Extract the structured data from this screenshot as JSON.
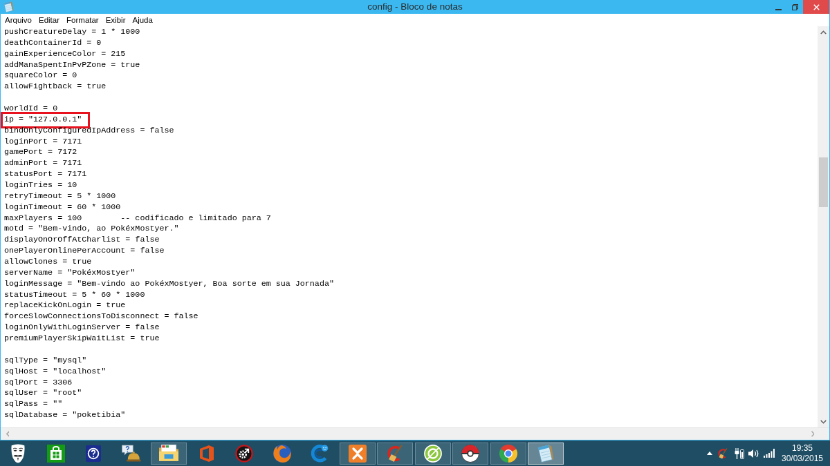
{
  "window": {
    "title": "config - Bloco de notas"
  },
  "menu": [
    "Arquivo",
    "Editar",
    "Formatar",
    "Exibir",
    "Ajuda"
  ],
  "editor": {
    "blocks": [
      {
        "lines": [
          {
            "text": "pushCreatureDelay = 1 * 1000",
            "highlighted": false
          },
          {
            "text": "deathContainerId = 0",
            "highlighted": false
          },
          {
            "text": "gainExperienceColor = 215",
            "highlighted": false
          },
          {
            "text": "addManaSpentInPvPZone = true",
            "highlighted": false
          },
          {
            "text": "squareColor = 0",
            "highlighted": false
          },
          {
            "text": "allowFightback = true",
            "highlighted": false
          }
        ]
      },
      {
        "lines": [
          {
            "text": "worldId = 0",
            "highlighted": false
          },
          {
            "text": "ip = \"127.0.0.1\"",
            "highlighted": true
          },
          {
            "text": "bindOnlyConfiguredIpAddress = false",
            "highlighted": false
          },
          {
            "text": "loginPort = 7171",
            "highlighted": false
          },
          {
            "text": "gamePort = 7172",
            "highlighted": false
          },
          {
            "text": "adminPort = 7171",
            "highlighted": false
          },
          {
            "text": "statusPort = 7171",
            "highlighted": false
          },
          {
            "text": "loginTries = 10",
            "highlighted": false
          },
          {
            "text": "retryTimeout = 5 * 1000",
            "highlighted": false
          },
          {
            "text": "loginTimeout = 60 * 1000",
            "highlighted": false
          },
          {
            "text": "maxPlayers = 100        -- codificado e limitado para 7",
            "highlighted": false
          },
          {
            "text": "motd = \"Bem-vindo, ao PokéxMostyer.\"",
            "highlighted": false
          },
          {
            "text": "displayOnOrOffAtCharlist = false",
            "highlighted": false
          },
          {
            "text": "onePlayerOnlinePerAccount = false",
            "highlighted": false
          },
          {
            "text": "allowClones = true",
            "highlighted": false
          },
          {
            "text": "serverName = \"PokéxMostyer\"",
            "highlighted": false
          },
          {
            "text": "loginMessage = \"Bem-vindo ao PokéxMostyer, Boa sorte em sua Jornada\"",
            "highlighted": false
          },
          {
            "text": "statusTimeout = 5 * 60 * 1000",
            "highlighted": false
          },
          {
            "text": "replaceKickOnLogin = true",
            "highlighted": false
          },
          {
            "text": "forceSlowConnectionsToDisconnect = false",
            "highlighted": false
          },
          {
            "text": "loginOnlyWithLoginServer = false",
            "highlighted": false
          },
          {
            "text": "premiumPlayerSkipWaitList = true",
            "highlighted": false
          }
        ]
      },
      {
        "lines": [
          {
            "text": "sqlType = \"mysql\"",
            "highlighted": false
          },
          {
            "text": "sqlHost = \"localhost\"",
            "highlighted": false
          },
          {
            "text": "sqlPort = 3306",
            "highlighted": false
          },
          {
            "text": "sqlUser = \"root\"",
            "highlighted": false
          },
          {
            "text": "sqlPass = \"\"",
            "highlighted": false
          },
          {
            "text": "sqlDatabase = \"poketibia\"",
            "highlighted": false
          }
        ]
      }
    ]
  },
  "taskbar": {
    "apps": [
      {
        "running": false,
        "selected": false
      },
      {
        "running": false,
        "selected": false
      },
      {
        "running": false,
        "selected": false
      },
      {
        "running": false,
        "selected": false
      },
      {
        "running": true,
        "selected": false
      },
      {
        "running": false,
        "selected": false
      },
      {
        "running": false,
        "selected": false
      },
      {
        "running": false,
        "selected": false
      },
      {
        "running": false,
        "selected": false
      },
      {
        "running": true,
        "selected": false
      },
      {
        "running": true,
        "selected": false
      },
      {
        "running": true,
        "selected": false
      },
      {
        "running": true,
        "selected": false
      },
      {
        "running": true,
        "selected": false
      },
      {
        "running": true,
        "selected": true
      }
    ],
    "clock": {
      "time": "19:35",
      "date": "30/03/2015"
    }
  }
}
